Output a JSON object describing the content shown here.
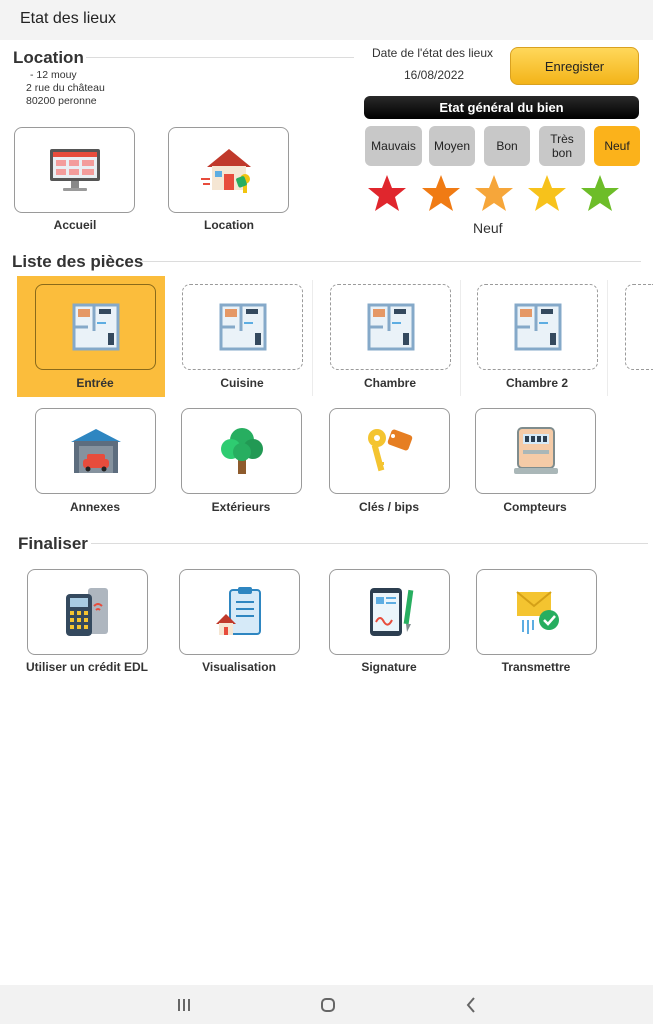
{
  "app": {
    "title": "Etat des lieux"
  },
  "location": {
    "heading": "Location",
    "address": [
      "- 12 mouy",
      "2 rue du château",
      "80200 peronne"
    ]
  },
  "date": {
    "label": "Date de l'état des lieux",
    "value": "16/08/2022"
  },
  "save_label": "Enregister",
  "etat": {
    "title": "Etat général du bien",
    "options": [
      "Mauvais",
      "Moyen",
      "Bon",
      "Très bon",
      "Neuf"
    ],
    "selected": "Neuf",
    "selected_index": 4,
    "star_colors": [
      "#e0262d",
      "#f07b14",
      "#f6a63a",
      "#f7c21b",
      "#6dbd29"
    ]
  },
  "nav_tiles": [
    "Accueil",
    "Location"
  ],
  "pieces": {
    "heading": "Liste des pièces",
    "rooms": [
      "Entrée",
      "Cuisine",
      "Chambre",
      "Chambre 2"
    ],
    "selected_room": "Entrée",
    "extras": [
      "Annexes",
      "Extérieurs",
      "Clés / bips",
      "Compteurs"
    ]
  },
  "finaliser": {
    "heading": "Finaliser",
    "items": [
      "Utiliser un crédit EDL",
      "Visualisation",
      "Signature",
      "Transmettre"
    ]
  },
  "icons": {
    "accueil": "monitor-icon",
    "location": "house-key-icon",
    "room": "floor-plan-icon",
    "annexes": "garage-icon",
    "exterieurs": "tree-icon",
    "cles": "keys-icon",
    "compteurs": "meter-icon",
    "credit": "payment-terminal-icon",
    "visualisation": "clipboard-house-icon",
    "signature": "tablet-pen-icon",
    "transmettre": "envelope-check-icon",
    "star": "star-icon"
  }
}
